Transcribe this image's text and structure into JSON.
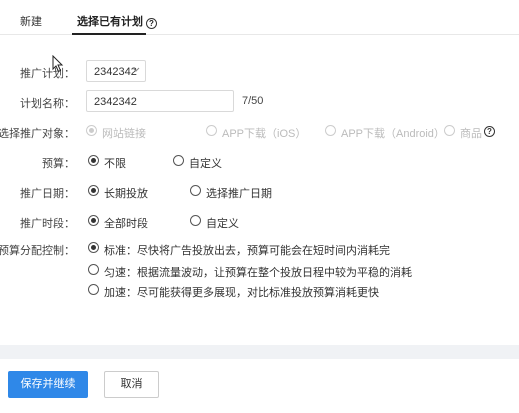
{
  "tabs": {
    "new": "新建",
    "existing": "选择已有计划",
    "help_icon": "?"
  },
  "form": {
    "plan": {
      "label": "推广计划：",
      "value": "2342342"
    },
    "plan_name": {
      "label": "计划名称：",
      "value": "2342342",
      "counter": "7/50"
    },
    "target": {
      "label": "选择推广对象：",
      "options": [
        "网站链接",
        "APP下载（iOS）",
        "APP下载（Android）",
        "商品"
      ],
      "help_icon": "?"
    },
    "budget": {
      "label": "预算：",
      "options": [
        "不限",
        "自定义"
      ]
    },
    "date": {
      "label": "推广日期：",
      "options": [
        "长期投放",
        "选择推广日期"
      ]
    },
    "time": {
      "label": "推广时段：",
      "options": [
        "全部时段",
        "自定义"
      ]
    },
    "pacing": {
      "label": "预算分配控制：",
      "options": [
        "标准：尽快将广告投放出去，预算可能会在短时间内消耗完",
        "匀速：根据流量波动，让预算在整个投放日程中较为平稳的消耗",
        "加速：尽可能获得更多展现，对比标准投放预算消耗更快"
      ]
    }
  },
  "footer": {
    "save": "保存并继续",
    "cancel": "取消"
  }
}
